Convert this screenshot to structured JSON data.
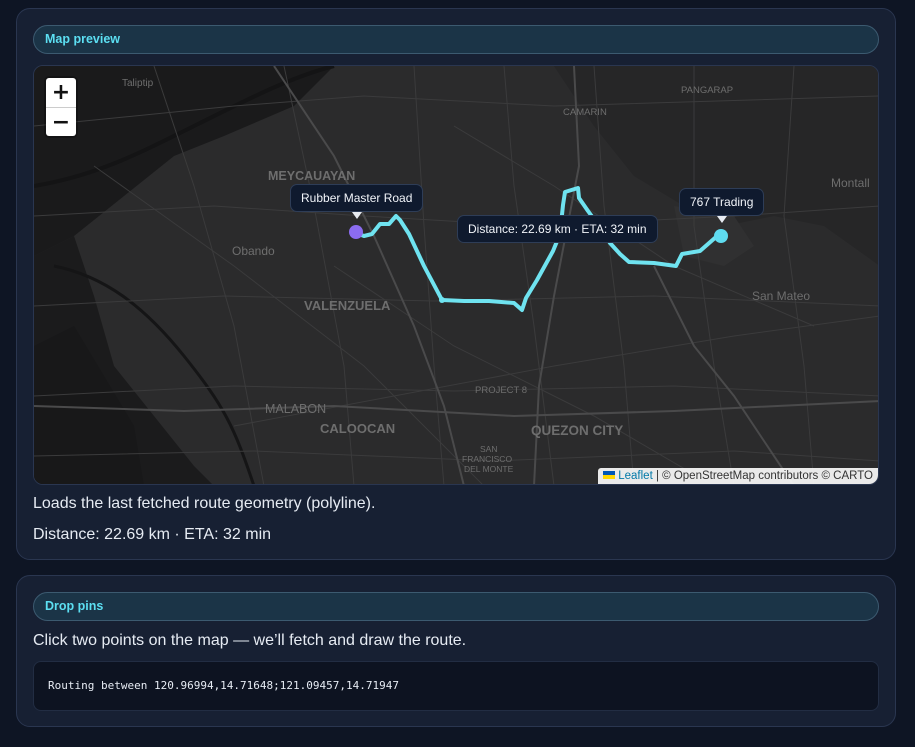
{
  "map_card": {
    "title": "Map preview",
    "zoom_in": "+",
    "zoom_out": "−",
    "start_label": "Rubber Master Road",
    "end_label": "767 Trading",
    "route_tooltip": "Distance: 22.69 km · ETA: 32 min",
    "attribution_link": "Leaflet",
    "attribution_text": " | © OpenStreetMap contributors © CARTO",
    "place_labels": {
      "taliptip": "Taliptip",
      "camarin": "CAMARIN",
      "pangarap": "PANGARAP",
      "meycauayan": "MEYCAUAYAN",
      "montalban": "Montall",
      "obando": "Obando",
      "valenzuela": "VALENZUELA",
      "san_mateo": "San Mateo",
      "project8": "PROJECT 8",
      "malabon": "MALABON",
      "caloocan": "CALOOCAN",
      "quezon_city": "QUEZON CITY",
      "san_francisco_1": "SAN",
      "san_francisco_2": "FRANCISCO",
      "san_francisco_3": "DEL MONTE"
    },
    "description": "Loads the last fetched route geometry (polyline).",
    "summary": "Distance: 22.69 km · ETA: 32 min",
    "colors": {
      "route": "#6fe3f0",
      "start_marker": "#8b6cf0",
      "end_marker": "#5fdcf0",
      "accent": "#5cdff2"
    }
  },
  "pins_card": {
    "title": "Drop pins",
    "instructions": "Click two points on the map — we’ll fetch and draw the route.",
    "routing_text": "Routing between 120.96994,14.71648;121.09457,14.71947"
  }
}
